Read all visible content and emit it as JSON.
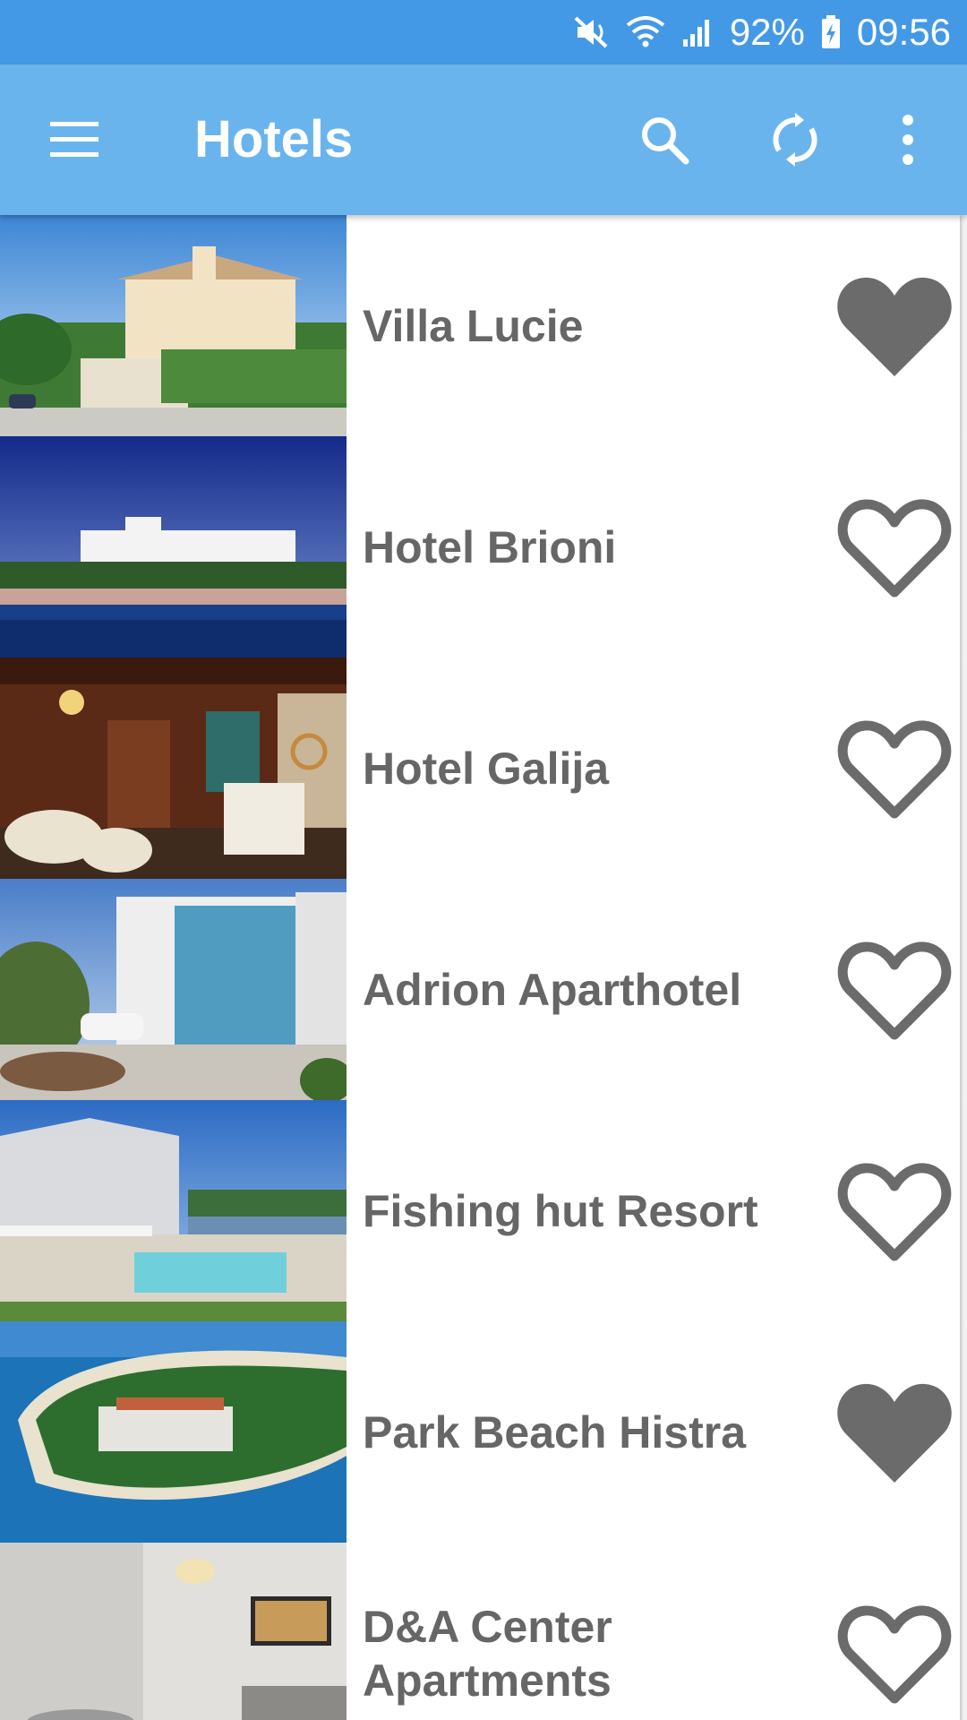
{
  "status_bar": {
    "icons": [
      "mute-icon",
      "wifi-icon",
      "signal-icon"
    ],
    "battery": "92%",
    "battery_icon": "battery-charging-icon",
    "time": "09:56"
  },
  "app_bar": {
    "title": "Hotels",
    "menu_icon": "menu-icon",
    "search_icon": "search-icon",
    "refresh_icon": "refresh-icon",
    "overflow_icon": "more-vert-icon"
  },
  "colors": {
    "status_bar": "#4499e6",
    "app_bar": "#6ab4ee",
    "text": "#666666",
    "heart": "#6b6b6b"
  },
  "hotels": [
    {
      "name": "Villa Lucie",
      "favorite": true,
      "image": "villa-lucie-photo"
    },
    {
      "name": "Hotel Brioni",
      "favorite": false,
      "image": "hotel-brioni-photo"
    },
    {
      "name": "Hotel Galija",
      "favorite": false,
      "image": "hotel-galija-photo"
    },
    {
      "name": "Adrion Aparthotel",
      "favorite": false,
      "image": "adrion-aparthotel-photo"
    },
    {
      "name": "Fishing hut Resort",
      "favorite": false,
      "image": "fishing-hut-resort-photo"
    },
    {
      "name": "Park Beach Histra",
      "favorite": true,
      "image": "park-beach-histra-photo"
    },
    {
      "name": "D&A Center Apartments",
      "favorite": false,
      "image": "da-center-apartments-photo"
    }
  ]
}
